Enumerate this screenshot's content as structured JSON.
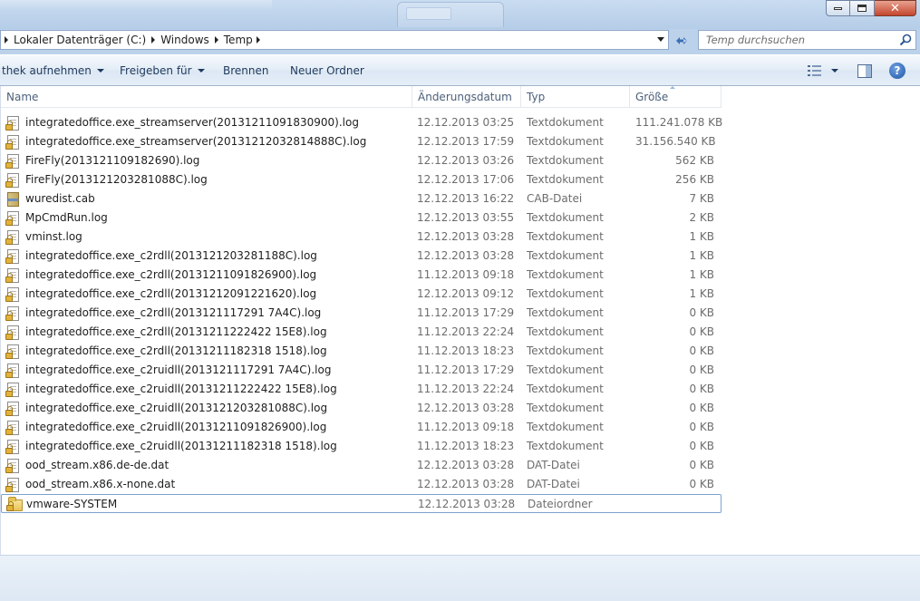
{
  "address": {
    "crumbs": [
      "Lokaler Datenträger (C:)",
      "Windows",
      "Temp"
    ]
  },
  "search": {
    "placeholder": "Temp durchsuchen"
  },
  "commands": {
    "library": "thek aufnehmen",
    "share": "Freigeben für",
    "burn": "Brennen",
    "new_folder": "Neuer Ordner"
  },
  "columns": {
    "name": "Name",
    "date": "Änderungsdatum",
    "type": "Typ",
    "size": "Größe"
  },
  "files": [
    {
      "name": "integratedoffice.exe_streamserver(20131211091830900).log",
      "date": "12.12.2013 03:25",
      "type": "Textdokument",
      "size": "111.241.078 KB",
      "icon": "text-file-locked-icon"
    },
    {
      "name": "integratedoffice.exe_streamserver(20131212032814888C).log",
      "date": "12.12.2013 17:59",
      "type": "Textdokument",
      "size": "31.156.540 KB",
      "icon": "text-file-locked-icon"
    },
    {
      "name": "FireFly(2013121109182690).log",
      "date": "12.12.2013 03:26",
      "type": "Textdokument",
      "size": "562 KB",
      "icon": "text-file-locked-icon"
    },
    {
      "name": "FireFly(2013121203281088C).log",
      "date": "12.12.2013 17:06",
      "type": "Textdokument",
      "size": "256 KB",
      "icon": "text-file-locked-icon"
    },
    {
      "name": "wuredist.cab",
      "date": "12.12.2013 16:22",
      "type": "CAB-Datei",
      "size": "7 KB",
      "icon": "cab-file-icon"
    },
    {
      "name": "MpCmdRun.log",
      "date": "12.12.2013 03:55",
      "type": "Textdokument",
      "size": "2 KB",
      "icon": "text-file-locked-icon"
    },
    {
      "name": "vminst.log",
      "date": "12.12.2013 03:28",
      "type": "Textdokument",
      "size": "1 KB",
      "icon": "text-file-locked-icon"
    },
    {
      "name": "integratedoffice.exe_c2rdll(2013121203281188C).log",
      "date": "12.12.2013 03:28",
      "type": "Textdokument",
      "size": "1 KB",
      "icon": "text-file-locked-icon"
    },
    {
      "name": "integratedoffice.exe_c2rdll(20131211091826900).log",
      "date": "11.12.2013 09:18",
      "type": "Textdokument",
      "size": "1 KB",
      "icon": "text-file-locked-icon"
    },
    {
      "name": "integratedoffice.exe_c2rdll(20131212091221620).log",
      "date": "12.12.2013 09:12",
      "type": "Textdokument",
      "size": "1 KB",
      "icon": "text-file-locked-icon"
    },
    {
      "name": "integratedoffice.exe_c2rdll(2013121117291 7A4C).log",
      "date": "11.12.2013 17:29",
      "type": "Textdokument",
      "size": "0 KB",
      "icon": "text-file-locked-icon"
    },
    {
      "name": "integratedoffice.exe_c2rdll(20131211222422 15E8).log",
      "date": "11.12.2013 22:24",
      "type": "Textdokument",
      "size": "0 KB",
      "icon": "text-file-locked-icon"
    },
    {
      "name": "integratedoffice.exe_c2rdll(20131211182318 1518).log",
      "date": "11.12.2013 18:23",
      "type": "Textdokument",
      "size": "0 KB",
      "icon": "text-file-locked-icon"
    },
    {
      "name": "integratedoffice.exe_c2ruidll(2013121117291 7A4C).log",
      "date": "11.12.2013 17:29",
      "type": "Textdokument",
      "size": "0 KB",
      "icon": "text-file-locked-icon"
    },
    {
      "name": "integratedoffice.exe_c2ruidll(20131211222422 15E8).log",
      "date": "11.12.2013 22:24",
      "type": "Textdokument",
      "size": "0 KB",
      "icon": "text-file-locked-icon"
    },
    {
      "name": "integratedoffice.exe_c2ruidll(2013121203281088C).log",
      "date": "12.12.2013 03:28",
      "type": "Textdokument",
      "size": "0 KB",
      "icon": "text-file-locked-icon"
    },
    {
      "name": "integratedoffice.exe_c2ruidll(20131211091826900).log",
      "date": "11.12.2013 09:18",
      "type": "Textdokument",
      "size": "0 KB",
      "icon": "text-file-locked-icon"
    },
    {
      "name": "integratedoffice.exe_c2ruidll(20131211182318 1518).log",
      "date": "11.12.2013 18:23",
      "type": "Textdokument",
      "size": "0 KB",
      "icon": "text-file-locked-icon"
    },
    {
      "name": "ood_stream.x86.de-de.dat",
      "date": "12.12.2013 03:28",
      "type": "DAT-Datei",
      "size": "0 KB",
      "icon": "dat-file-locked-icon"
    },
    {
      "name": "ood_stream.x86.x-none.dat",
      "date": "12.12.2013 03:28",
      "type": "DAT-Datei",
      "size": "0 KB",
      "icon": "dat-file-locked-icon"
    },
    {
      "name": "vmware-SYSTEM",
      "date": "12.12.2013 03:28",
      "type": "Dateiordner",
      "size": "",
      "icon": "folder-locked-icon",
      "selected": true
    }
  ]
}
